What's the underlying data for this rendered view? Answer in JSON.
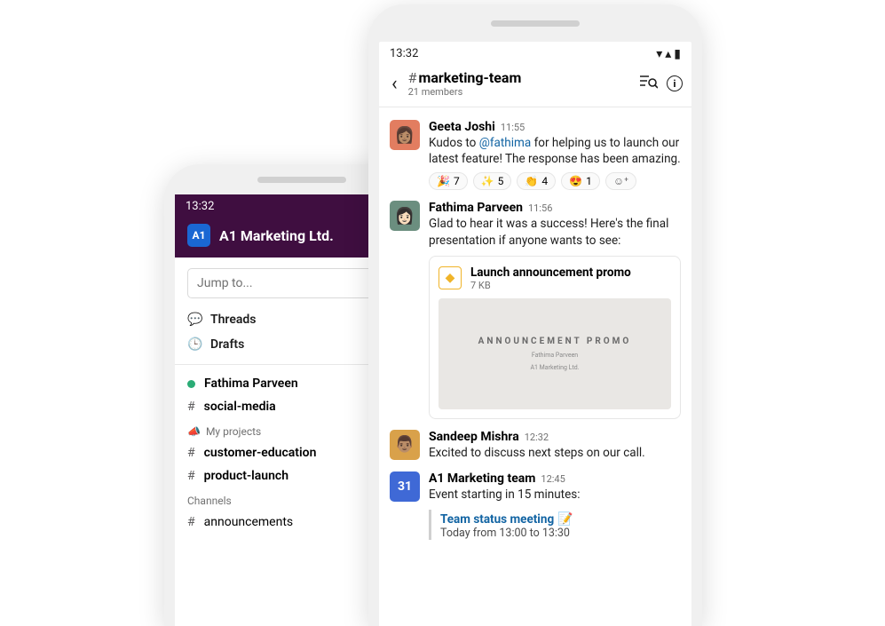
{
  "status_time": "13:32",
  "left": {
    "workspace_badge": "A1",
    "workspace_name": "A1 Marketing Ltd.",
    "jump_placeholder": "Jump to...",
    "threads_label": "Threads",
    "drafts_label": "Drafts",
    "dm_name": "Fathima Parveen",
    "social_channel": "social-media",
    "projects_section": "My projects",
    "proj_channel_1": "customer-education",
    "proj_channel_2": "product-launch",
    "channels_section": "Channels",
    "channel_1": "announcements"
  },
  "right": {
    "channel_name": "marketing-team",
    "channel_members": "21 members",
    "m1": {
      "author": "Geeta Joshi",
      "time": "11:55",
      "text_a": "Kudos to ",
      "mention": "@fathima",
      "text_b": " for helping us to launch our latest feature! The response has been amazing.",
      "reactions": {
        "tada": {
          "emoji": "🎉",
          "count": "7"
        },
        "sparkles": {
          "emoji": "✨",
          "count": "5"
        },
        "clap": {
          "emoji": "👏",
          "count": "4"
        },
        "heart_eyes": {
          "emoji": "😍",
          "count": "1"
        }
      }
    },
    "m2": {
      "author": "Fathima Parveen",
      "time": "11:56",
      "text": "Glad to hear it was a success! Here's the final presentation if anyone wants to see:",
      "file": {
        "name": "Launch announcement promo",
        "size": "7 KB",
        "preview_title": "ANNOUNCEMENT PROMO",
        "preview_sub1": "Fathima Parveen",
        "preview_sub2": "A1 Marketing Ltd."
      }
    },
    "m3": {
      "author": "Sandeep Mishra",
      "time": "12:32",
      "text": "Excited to discuss next steps on our call."
    },
    "m4": {
      "author": "A1 Marketing team",
      "time": "12:45",
      "calendar_day": "31",
      "text": "Event starting in 15 minutes:",
      "event_title": "Team status meeting",
      "event_emoji": "📝",
      "event_time": "Today from 13:00 to 13:30"
    }
  }
}
